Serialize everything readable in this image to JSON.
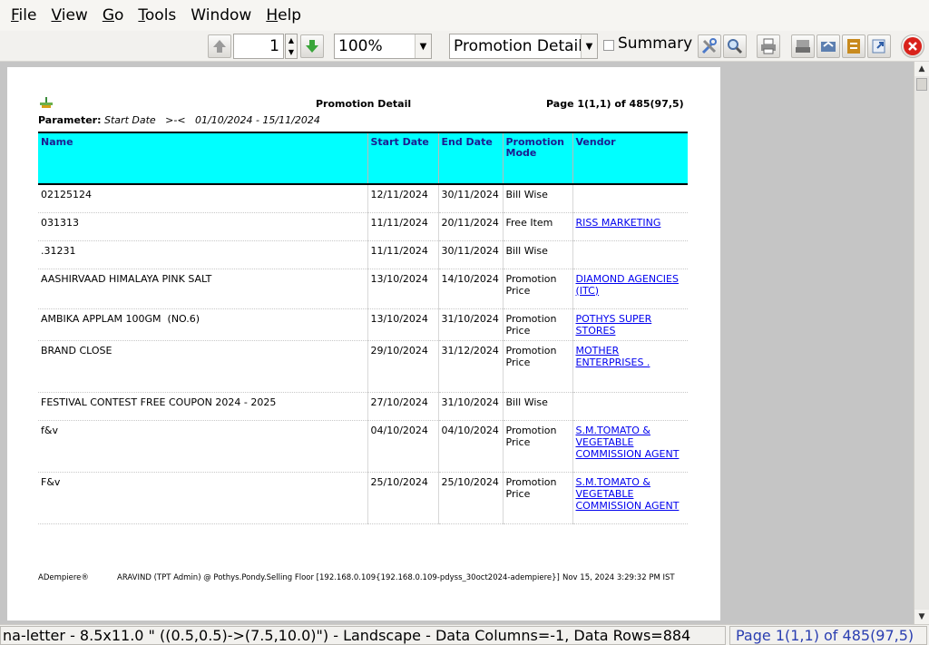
{
  "menu": {
    "items": [
      {
        "key": "F",
        "rest": "ile"
      },
      {
        "key": "V",
        "rest": "iew"
      },
      {
        "key": "G",
        "rest": "o"
      },
      {
        "key": "T",
        "rest": "ools"
      },
      {
        "key": "W",
        "rest": "indow",
        "plain": "Window"
      },
      {
        "key": "H",
        "rest": "elp"
      }
    ]
  },
  "toolbar": {
    "page_value": "1",
    "zoom_value": "100%",
    "report_value": "Promotion Detail",
    "summary_label": "Summary"
  },
  "report": {
    "title": "Promotion Detail",
    "page_info": "Page 1(1,1) of 485(97,5)",
    "parameter_label": "Parameter:",
    "parameter_value": "Start Date   >-<   01/10/2024 - 15/11/2024",
    "columns": [
      "Name",
      "Start Date",
      "End Date",
      "Promotion Mode",
      "Vendor"
    ],
    "rows": [
      {
        "name": "02125124",
        "start": "12/11/2024",
        "end": "30/11/2024",
        "mode": "Bill Wise",
        "vendor": ""
      },
      {
        "name": "031313",
        "start": "11/11/2024",
        "end": "20/11/2024",
        "mode": "Free Item",
        "vendor": "RISS MARKETING"
      },
      {
        "name": ".31231",
        "start": "11/11/2024",
        "end": "30/11/2024",
        "mode": "Bill Wise",
        "vendor": ""
      },
      {
        "name": "AASHIRVAAD HIMALAYA PINK SALT",
        "start": "13/10/2024",
        "end": "14/10/2024",
        "mode": "Promotion Price",
        "vendor": "DIAMOND AGENCIES (ITC)"
      },
      {
        "name": "AMBIKA APPLAM 100GM  (NO.6)",
        "start": "13/10/2024",
        "end": "31/10/2024",
        "mode": "Promotion Price",
        "vendor": "POTHYS SUPER STORES"
      },
      {
        "name": "BRAND CLOSE",
        "start": "29/10/2024",
        "end": "31/12/2024",
        "mode": "Promotion Price",
        "vendor": "MOTHER ENTERPRISES ."
      },
      {
        "name": "FESTIVAL CONTEST FREE COUPON 2024 - 2025",
        "start": "27/10/2024",
        "end": "31/10/2024",
        "mode": "Bill Wise",
        "vendor": ""
      },
      {
        "name": "f&v",
        "start": "04/10/2024",
        "end": "04/10/2024",
        "mode": "Promotion Price",
        "vendor": "S.M.TOMATO & VEGETABLE COMMISSION AGENT"
      },
      {
        "name": "F&v",
        "start": "25/10/2024",
        "end": "25/10/2024",
        "mode": "Promotion Price",
        "vendor": "S.M.TOMATO & VEGETABLE COMMISSION AGENT"
      }
    ],
    "footer_brand": "ADempiere®",
    "footer_user": "ARAVIND (TPT Admin) @ Pothys.Pondy.Selling Floor [192.168.0.109{192.168.0.109-pdyss_30oct2024-adempiere}]",
    "footer_time": "Nov 15, 2024 3:29:32 PM IST"
  },
  "status": {
    "left": "na-letter - 8.5x11.0 \" ((0.5,0.5)->(7.5,10.0)\") - Landscape - Data Columns=-1, Data Rows=884",
    "right": "Page 1(1,1) of 485(97,5)"
  },
  "colors": {
    "header_bg": "#00ffff",
    "header_text": "#1c1c90",
    "link": "#0000ee",
    "close_button": "#d9221b"
  }
}
